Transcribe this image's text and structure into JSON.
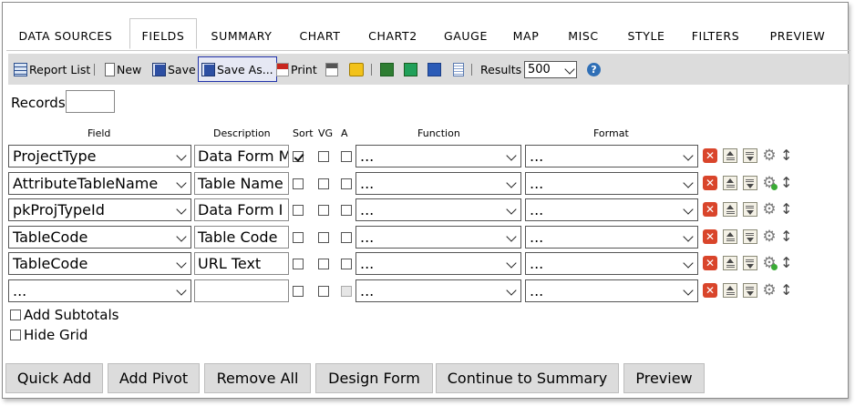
{
  "tabs": [
    "DATA SOURCES",
    "FIELDS",
    "SUMMARY",
    "CHART",
    "CHART2",
    "GAUGE",
    "MAP",
    "MISC",
    "STYLE",
    "FILTERS",
    "PREVIEW"
  ],
  "active_tab": "FIELDS",
  "toolbar": {
    "report_list": "Report List",
    "new": "New",
    "save": "Save",
    "save_as": "Save As...",
    "print": "Print",
    "results_label": "Results",
    "results_value": "500",
    "icons": {
      "report_list": "report-list-icon",
      "new": "new-document-icon",
      "save": "floppy-disk-icon",
      "save_as": "floppy-disk-icon",
      "print": "pdf-icon",
      "html": "html-icon",
      "sql": "sql-icon",
      "excel1": "excel-icon",
      "excel2": "excel-icon",
      "word": "word-icon",
      "text": "text-file-icon",
      "help": "help-icon"
    }
  },
  "records": {
    "label": "Records",
    "value": ""
  },
  "headers": {
    "field": "Field",
    "description": "Description",
    "sort": "Sort",
    "vg": "VG",
    "a": "A",
    "function": "Function",
    "format": "Format"
  },
  "rows": [
    {
      "field": "ProjectType",
      "description": "Data Form M",
      "sort": true,
      "vg": false,
      "a": false,
      "a_enabled": true,
      "function": "...",
      "format": "...",
      "gear_status": "plain"
    },
    {
      "field": "AttributeTableName",
      "description": "Table Name",
      "sort": false,
      "vg": false,
      "a": false,
      "a_enabled": true,
      "function": "...",
      "format": "...",
      "gear_status": "green"
    },
    {
      "field": "pkProjTypeId",
      "description": "Data Form I",
      "sort": false,
      "vg": false,
      "a": false,
      "a_enabled": true,
      "function": "...",
      "format": "...",
      "gear_status": "plain"
    },
    {
      "field": "TableCode",
      "description": "Table Code",
      "sort": false,
      "vg": false,
      "a": false,
      "a_enabled": true,
      "function": "...",
      "format": "...",
      "gear_status": "plain"
    },
    {
      "field": "TableCode",
      "description": "URL Text",
      "sort": false,
      "vg": false,
      "a": false,
      "a_enabled": true,
      "function": "...",
      "format": "...",
      "gear_status": "green"
    },
    {
      "field": "...",
      "description": "",
      "sort": false,
      "vg": false,
      "a": false,
      "a_enabled": false,
      "function": "...",
      "format": "...",
      "gear_status": "plain"
    }
  ],
  "options": {
    "add_subtotals": "Add Subtotals",
    "hide_grid": "Hide Grid"
  },
  "buttons": [
    "Quick Add",
    "Add Pivot",
    "Remove All",
    "Design Form",
    "Continue to Summary",
    "Preview"
  ],
  "colors": {
    "toolbar_bg": "#dcdcdc",
    "delete_icon": "#d9452b",
    "save_as_border": "#2233aa",
    "help_icon": "#2f6fb6"
  }
}
